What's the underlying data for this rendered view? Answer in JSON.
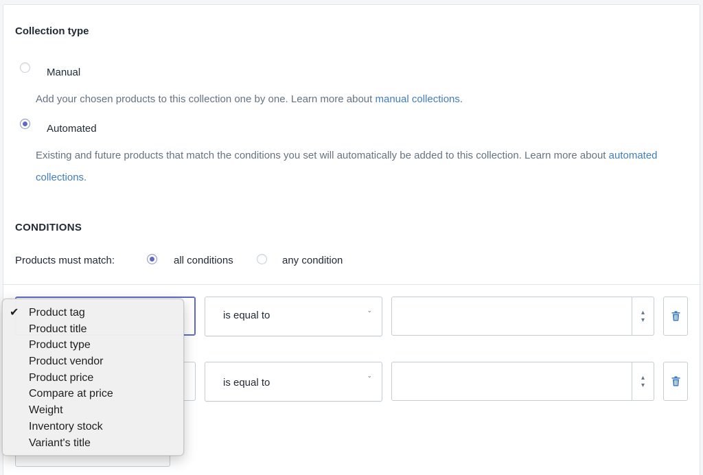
{
  "collection_type": {
    "title": "Collection type",
    "manual": {
      "label": "Manual",
      "help_text": "Add your chosen products to this collection one by one. Learn more about ",
      "help_link": "manual collections",
      "help_end": ".",
      "selected": false
    },
    "automated": {
      "label": "Automated",
      "help_text": "Existing and future products that match the conditions you set will automatically be added to this collection. Learn more about ",
      "help_link": "automated collections",
      "help_end": ".",
      "selected": true
    }
  },
  "conditions": {
    "title": "CONDITIONS",
    "match_label": "Products must match:",
    "all_label": "all conditions",
    "any_label": "any condition",
    "selected_match": "all",
    "rows": [
      {
        "relation": "is equal to",
        "value": ""
      },
      {
        "relation": "is equal to",
        "value": ""
      }
    ]
  },
  "property_dropdown": {
    "selected": "Product tag",
    "options": [
      "Product tag",
      "Product title",
      "Product type",
      "Product vendor",
      "Product price",
      "Compare at price",
      "Weight",
      "Inventory stock",
      "Variant's title"
    ]
  },
  "icons": {
    "delete": "trash-icon",
    "stepper": "updown-chevron-icon",
    "select_caret": "chevron-down-icon",
    "check": "checkmark-icon"
  },
  "colors": {
    "accent": "#5c6ac4",
    "link": "#3f7dc1",
    "muted_text": "#637381",
    "border": "#c4cdd5"
  }
}
